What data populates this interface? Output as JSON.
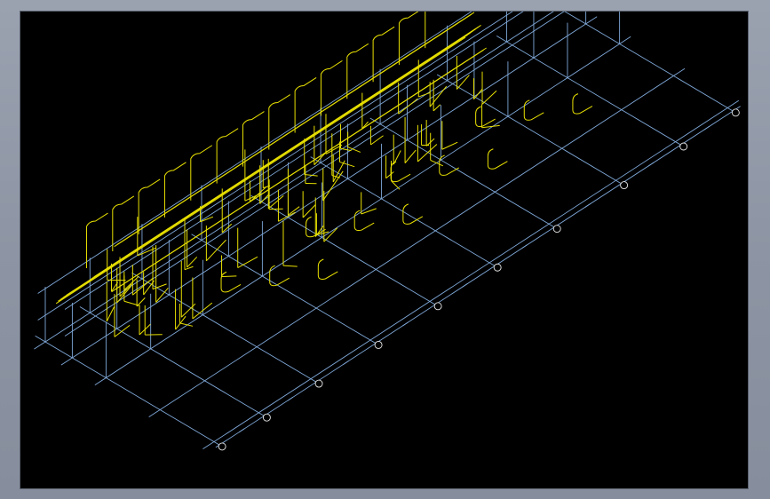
{
  "viewport": {
    "background": "#000000",
    "colors": {
      "grid": "#7fa8d8",
      "piping": "#e8e000",
      "annotation": "#e8e8e8",
      "chrome": "#8d95a4"
    }
  }
}
